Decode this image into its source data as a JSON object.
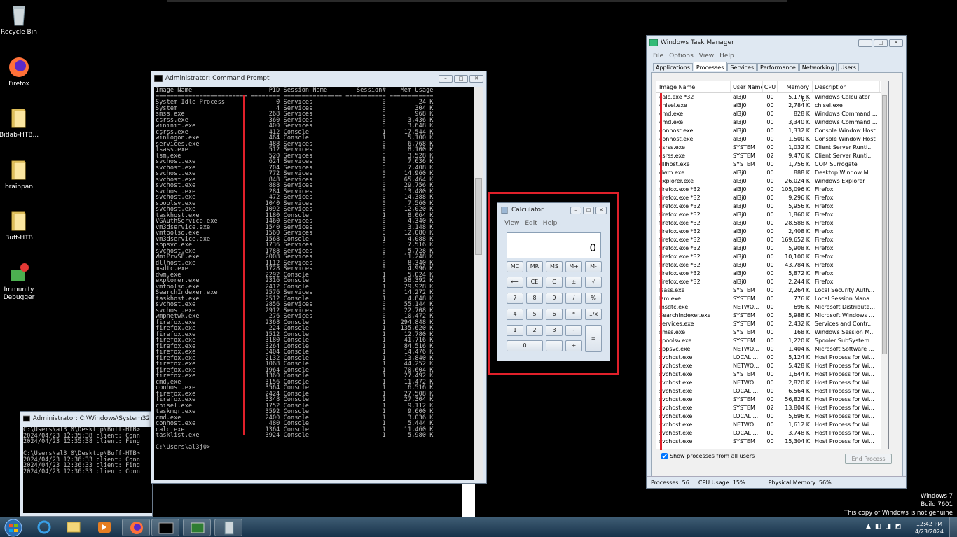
{
  "desktop": {
    "icons": [
      {
        "label": "Recycle Bin",
        "icon": "recycle-bin-icon"
      },
      {
        "label": "Firefox",
        "icon": "firefox-icon"
      },
      {
        "label": "Bitlab-HTB...",
        "icon": "folder-icon"
      },
      {
        "label": "brainpan",
        "icon": "folder-icon"
      },
      {
        "label": "Buff-HTB",
        "icon": "folder-icon"
      },
      {
        "label": "Immunity Debugger",
        "icon": "debugger-icon"
      }
    ]
  },
  "cmd_main": {
    "title": "Administrator: Command Prompt",
    "content": "Image Name                     PID Session Name        Session#    Mem Usage\n========================= ======== ================ =========== ============\nSystem Idle Process              0 Services                   0         24 K\nSystem                           4 Services                   0        304 K\nsmss.exe                       268 Services                   0        968 K\ncsrss.exe                      360 Services                   0      3,436 K\nwininit.exe                    400 Services                   0      3,648 K\ncsrss.exe                      412 Console                    1     17,544 K\nwinlogon.exe                   464 Console                    1      5,100 K\nservices.exe                   488 Services                   0      6,768 K\nlsass.exe                      512 Services                   0      8,100 K\nlsm.exe                        520 Services                   0      3,528 K\nsvchost.exe                    624 Services                   0      7,636 K\nsvchost.exe                    704 Services                   0      7,408 K\nsvchost.exe                    772 Services                   0     14,960 K\nsvchost.exe                    848 Services                   0     65,464 K\nsvchost.exe                    888 Services                   0     29,756 K\nsvchost.exe                    284 Services                   0     13,480 K\nsvchost.exe                    472 Services                   0     14,388 K\nspoolsv.exe                   1040 Services                   0      7,560 K\nsvchost.exe                   1092 Services                   0     12,020 K\ntaskhost.exe                  1180 Console                    1      8,064 K\nVGAuthService.exe             1460 Services                   0      4,340 K\nvm3dservice.exe               1540 Services                   0      3,148 K\nvmtoolsd.exe                  1560 Services                   0     12,080 K\nvm3dservice.exe               1568 Console                    1      4,088 K\nsppsvc.exe                    1736 Services                   0      7,516 K\nsvchost.exe                   1788 Services                   0      5,728 K\nWmiPrvSE.exe                  2008 Services                   0     11,248 K\ndllhost.exe                   1112 Services                   0      8,340 K\nmsdtc.exe                     1728 Services                   0      4,996 K\ndwm.exe                       2292 Console                    1      5,024 K\nexplorer.exe                  2316 Console                    1     58,392 K\nvmtoolsd.exe                  2412 Console                    1     29,928 K\nSearchIndexer.exe             2576 Services                   0     14,272 K\ntaskhost.exe                  2512 Console                    1      4,848 K\nsvchost.exe                   2856 Services                   0     55,144 K\nsvchost.exe                   2912 Services                   0     22,708 K\nwmpnetwk.exe                   276 Services                   0     10,472 K\nfirefox.exe                   2368 Console                    1    294,848 K\nfirefox.exe                    224 Console                    1    135,620 K\nfirefox.exe                   1512 Console                    1     12,780 K\nfirefox.exe                   3180 Console                    1     41,716 K\nfirefox.exe                   3264 Console                    1     84,516 K\nfirefox.exe                   3404 Console                    1     14,476 K\nfirefox.exe                   2132 Console                    1     13,840 K\nfirefox.exe                   1068 Console                    1     44,252 K\nfirefox.exe                   1964 Console                    1     70,604 K\nfirefox.exe                   1360 Console                    1     27,492 K\ncmd.exe                       3156 Console                    1     11,472 K\nconhost.exe                   3564 Console                    1      6,516 K\nfirefox.exe                   2424 Console                    1     27,508 K\nfirefox.exe                   3348 Console                    1     27,304 K\nchisel.exe                    1752 Console                    1      9,112 K\ntaskmgr.exe                   3592 Console                    1      9,600 K\ncmd.exe                       2400 Console                    1      3,036 K\nconhost.exe                    480 Console                    1      5,444 K\ncalc.exe                      1364 Console                    1     11,460 K\ntasklist.exe                  3924 Console                    1      5,980 K\n\nC:\\Users\\al3j0>"
  },
  "cmd_back": {
    "title": "Administrator: C:\\Windows\\System32\\cmd.exe",
    "content": "C:\\Users\\al3j0\\Desktop\\Buff-HTB>\n2024/04/23 12:35:38 client: Conn\n2024/04/23 12:35:38 client: Fing\n\nC:\\Users\\al3j0\\Desktop\\Buff-HTB>\n2024/04/23 12:36:33 client: Conn\n2024/04/23 12:36:33 client: Fing\n2024/04/23 12:36:33 client: Conn"
  },
  "calculator": {
    "title": "Calculator",
    "menu": [
      "View",
      "Edit",
      "Help"
    ],
    "display": "0",
    "buttons": [
      [
        "MC",
        "MR",
        "MS",
        "M+",
        "M-"
      ],
      [
        "⟵",
        "CE",
        "C",
        "±",
        "√"
      ],
      [
        "7",
        "8",
        "9",
        "/",
        "%"
      ],
      [
        "4",
        "5",
        "6",
        "*",
        "1/x"
      ],
      [
        "1",
        "2",
        "3",
        "-",
        "="
      ],
      [
        "0",
        ".",
        "+"
      ]
    ]
  },
  "taskmgr": {
    "title": "Windows Task Manager",
    "menu": [
      "File",
      "Options",
      "View",
      "Help"
    ],
    "tabs": [
      "Applications",
      "Processes",
      "Services",
      "Performance",
      "Networking",
      "Users"
    ],
    "active_tab": "Processes",
    "columns": [
      "Image Name",
      "User Name",
      "CPU",
      "Memory (...",
      "Description"
    ],
    "rows": [
      [
        "calc.exe *32",
        "al3j0",
        "00",
        "5,176 K",
        "Windows Calculator"
      ],
      [
        "chisel.exe",
        "al3j0",
        "00",
        "2,784 K",
        "chisel.exe"
      ],
      [
        "cmd.exe",
        "al3j0",
        "00",
        "828 K",
        "Windows Command ..."
      ],
      [
        "cmd.exe",
        "al3j0",
        "00",
        "3,340 K",
        "Windows Command ..."
      ],
      [
        "conhost.exe",
        "al3j0",
        "00",
        "1,332 K",
        "Console Window Host"
      ],
      [
        "conhost.exe",
        "al3j0",
        "00",
        "1,500 K",
        "Console Window Host"
      ],
      [
        "csrss.exe",
        "SYSTEM",
        "00",
        "1,032 K",
        "Client Server Runti..."
      ],
      [
        "csrss.exe",
        "SYSTEM",
        "02",
        "9,476 K",
        "Client Server Runti..."
      ],
      [
        "dllhost.exe",
        "SYSTEM",
        "00",
        "1,756 K",
        "COM Surrogate"
      ],
      [
        "dwm.exe",
        "al3j0",
        "00",
        "888 K",
        "Desktop Window M..."
      ],
      [
        "explorer.exe",
        "al3j0",
        "00",
        "26,024 K",
        "Windows Explorer"
      ],
      [
        "firefox.exe *32",
        "al3j0",
        "00",
        "105,096 K",
        "Firefox"
      ],
      [
        "firefox.exe *32",
        "al3j0",
        "00",
        "9,296 K",
        "Firefox"
      ],
      [
        "firefox.exe *32",
        "al3j0",
        "00",
        "5,956 K",
        "Firefox"
      ],
      [
        "firefox.exe *32",
        "al3j0",
        "00",
        "1,860 K",
        "Firefox"
      ],
      [
        "firefox.exe *32",
        "al3j0",
        "00",
        "28,588 K",
        "Firefox"
      ],
      [
        "firefox.exe *32",
        "al3j0",
        "00",
        "2,408 K",
        "Firefox"
      ],
      [
        "firefox.exe *32",
        "al3j0",
        "00",
        "169,652 K",
        "Firefox"
      ],
      [
        "firefox.exe *32",
        "al3j0",
        "00",
        "5,908 K",
        "Firefox"
      ],
      [
        "firefox.exe *32",
        "al3j0",
        "00",
        "10,100 K",
        "Firefox"
      ],
      [
        "firefox.exe *32",
        "al3j0",
        "00",
        "43,784 K",
        "Firefox"
      ],
      [
        "firefox.exe *32",
        "al3j0",
        "00",
        "5,872 K",
        "Firefox"
      ],
      [
        "firefox.exe *32",
        "al3j0",
        "00",
        "2,244 K",
        "Firefox"
      ],
      [
        "lsass.exe",
        "SYSTEM",
        "00",
        "2,264 K",
        "Local Security Auth..."
      ],
      [
        "lsm.exe",
        "SYSTEM",
        "00",
        "776 K",
        "Local Session Mana..."
      ],
      [
        "msdtc.exe",
        "NETWO...",
        "00",
        "696 K",
        "Microsoft Distribute..."
      ],
      [
        "SearchIndexer.exe",
        "SYSTEM",
        "00",
        "5,988 K",
        "Microsoft Windows ..."
      ],
      [
        "services.exe",
        "SYSTEM",
        "00",
        "2,432 K",
        "Services and Contr..."
      ],
      [
        "smss.exe",
        "SYSTEM",
        "00",
        "168 K",
        "Windows Session M..."
      ],
      [
        "spoolsv.exe",
        "SYSTEM",
        "00",
        "1,220 K",
        "Spooler SubSystem ..."
      ],
      [
        "sppsvc.exe",
        "NETWO...",
        "00",
        "1,404 K",
        "Microsoft Software ..."
      ],
      [
        "svchost.exe",
        "LOCAL ...",
        "00",
        "5,124 K",
        "Host Process for Wi..."
      ],
      [
        "svchost.exe",
        "NETWO...",
        "00",
        "5,428 K",
        "Host Process for Wi..."
      ],
      [
        "svchost.exe",
        "SYSTEM",
        "00",
        "1,644 K",
        "Host Process for Wi..."
      ],
      [
        "svchost.exe",
        "NETWO...",
        "00",
        "2,820 K",
        "Host Process for Wi..."
      ],
      [
        "svchost.exe",
        "LOCAL ...",
        "00",
        "6,564 K",
        "Host Process for Wi..."
      ],
      [
        "svchost.exe",
        "SYSTEM",
        "00",
        "56,828 K",
        "Host Process for Wi..."
      ],
      [
        "svchost.exe",
        "SYSTEM",
        "02",
        "13,804 K",
        "Host Process for Wi..."
      ],
      [
        "svchost.exe",
        "LOCAL ...",
        "00",
        "5,696 K",
        "Host Process for Wi..."
      ],
      [
        "svchost.exe",
        "NETWO...",
        "00",
        "1,612 K",
        "Host Process for Wi..."
      ],
      [
        "svchost.exe",
        "LOCAL ...",
        "00",
        "3,748 K",
        "Host Process for Wi..."
      ],
      [
        "svchost.exe",
        "SYSTEM",
        "00",
        "15,304 K",
        "Host Process for Wi..."
      ]
    ],
    "show_all_label": "Show processes from all users",
    "end_process_label": "End Process",
    "status": {
      "processes": "Processes: 56",
      "cpu": "CPU Usage: 15%",
      "memory": "Physical Memory: 56%"
    }
  },
  "watermark": {
    "line1": "Windows 7",
    "line2": "Build 7601",
    "line3": "This copy of Windows is not genuine"
  },
  "taskbar": {
    "time": "12:42 PM",
    "date": "4/23/2024"
  },
  "colors": {
    "highlight": "#e0202a"
  }
}
